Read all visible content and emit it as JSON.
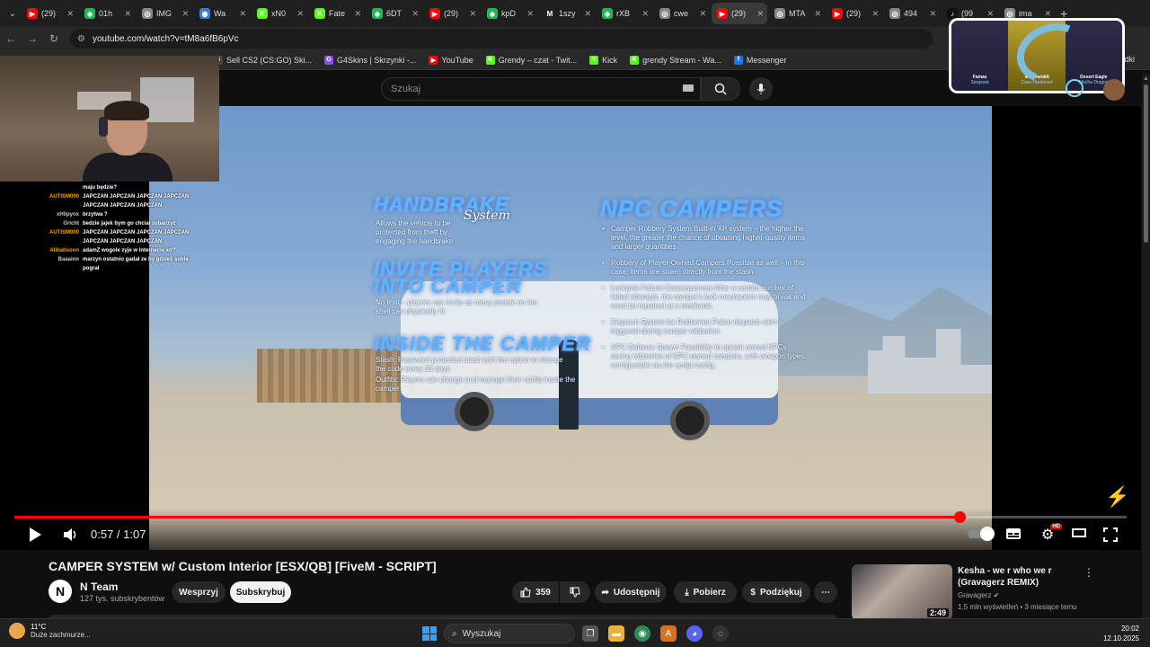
{
  "tabs": [
    {
      "label": "(29)",
      "color": "#ff0000",
      "glyph": "▶",
      "icon": "youtube-icon"
    },
    {
      "label": "01h",
      "color": "#1db954",
      "glyph": "◆",
      "icon": "app-icon"
    },
    {
      "label": "IMG",
      "color": "#888888",
      "glyph": "◎",
      "icon": "globe-icon"
    },
    {
      "label": "Wa",
      "color": "#3a7bd5",
      "glyph": "◉",
      "icon": "app-icon"
    },
    {
      "label": "xN0",
      "color": "#53fc18",
      "glyph": "K",
      "icon": "kick-icon"
    },
    {
      "label": "Fate",
      "color": "#53fc18",
      "glyph": "K",
      "icon": "kick-icon"
    },
    {
      "label": "6DT",
      "color": "#1db954",
      "glyph": "◆",
      "icon": "app-icon"
    },
    {
      "label": "(29)",
      "color": "#ff0000",
      "glyph": "▶",
      "icon": "youtube-icon"
    },
    {
      "label": "kpD",
      "color": "#1db954",
      "glyph": "◆",
      "icon": "app-icon"
    },
    {
      "label": "1szy",
      "color": "#222222",
      "glyph": "M",
      "icon": "app-icon"
    },
    {
      "label": "rXB",
      "color": "#1db954",
      "glyph": "◆",
      "icon": "app-icon"
    },
    {
      "label": "cwe",
      "color": "#888888",
      "glyph": "◎",
      "icon": "globe-icon"
    },
    {
      "label": "(29)",
      "color": "#ff0000",
      "glyph": "▶",
      "icon": "youtube-icon",
      "active": true
    },
    {
      "label": "MTA",
      "color": "#888888",
      "glyph": "◎",
      "icon": "globe-icon"
    },
    {
      "label": "(29)",
      "color": "#ff0000",
      "glyph": "▶",
      "icon": "youtube-icon"
    },
    {
      "label": "494",
      "color": "#888888",
      "glyph": "◎",
      "icon": "globe-icon"
    },
    {
      "label": "(99",
      "color": "#111111",
      "glyph": "♪",
      "icon": "tiktok-icon"
    },
    {
      "label": "ima",
      "color": "#888888",
      "glyph": "◎",
      "icon": "globe-icon"
    }
  ],
  "address": {
    "url": "youtube.com/watch?v=tM8a6fB6pVc"
  },
  "bookmarks": [
    {
      "label": "Sell CS2 (CS:GO) Ski...",
      "color": "#444444",
      "glyph": "S"
    },
    {
      "label": "G4Skins | Skrzynki -...",
      "color": "#8a4cf0",
      "glyph": "G"
    },
    {
      "label": "YouTube",
      "color": "#ff0000",
      "glyph": "▶"
    },
    {
      "label": "Grendy – czat - Twit...",
      "color": "#53fc18",
      "glyph": "K"
    },
    {
      "label": "Kick",
      "color": "#53fc18",
      "glyph": "K"
    },
    {
      "label": "grendy Stream - Wa...",
      "color": "#53fc18",
      "glyph": "K"
    },
    {
      "label": "Messenger",
      "color": "#1877f2",
      "glyph": "f"
    }
  ],
  "bookmarks_right": "kładki",
  "youtube": {
    "search_placeholder": "Szukaj"
  },
  "video": {
    "overlay": {
      "handbrake_title": "HANDBRAKE",
      "handbrake_tag": "System",
      "handbrake_desc": "Allows the vehicle to be protected from theft by engaging the handbrake",
      "invite_title_1": "INVITE PLAYERS",
      "invite_title_2": "INTO CAMPER",
      "invite_desc": "No limit – players can invite as many people as the shell can physically fit",
      "inside_title": "INSIDE THE CAMPER",
      "inside_b1": "Stash: Password-protected stash with the option to change the code every 30 days",
      "inside_b2": "Outfits: Players can change and manage their outfits inside the camper",
      "npc_title": "NPC CAMPERS",
      "npc_bullets": [
        "Camper Robbery System Built-in XP system – the higher the level, the greater the chance of obtaining higher-quality items and larger quantities.",
        "Robbery of Player-Owned Campers Possible as well – in this case, items are stolen directly from the stash.",
        "Lockpick Failure Consequences After a certain number of failed attempts, the camper's lock mechanism may break and must be repaired at a mechanic.",
        "Dispatch System for Robberies Police dispatch alert is triggered during camper robberies.",
        "NPC Defense Spawn Possibility to spawn armed NPCs during robberies of NPC-owned campers, with weapon types configurable via the script config."
      ]
    },
    "progress": 0.85,
    "time_current": "0:57",
    "time_separator": " / ",
    "time_total": "1:07",
    "quality_badge": "HD"
  },
  "chat": [
    {
      "user": "",
      "color": "#ff4040",
      "msg": "maju będzie?"
    },
    {
      "user": "AUTISM000",
      "color": "#ffa000",
      "msg": "JAPCZAN JAPCZAN JAPCZAN JAPCZAN"
    },
    {
      "user": "",
      "color": "#ffa000",
      "msg": "JAPCZAN JAPCZAN JAPCZAN"
    },
    {
      "user": "xHilpynx",
      "color": "#cccccc",
      "msg": "brzytwa ?"
    },
    {
      "user": "Gricht",
      "color": "#cccccc",
      "msg": "bedzie jajek bym go chciał zobaczyć"
    },
    {
      "user": "AUTISM000",
      "color": "#ffa000",
      "msg": "JAPCZAN JAPCZAN JAPCZAN JAPCZAN"
    },
    {
      "user": "",
      "color": "#ffa000",
      "msg": "JAPCZAN JAPCZAN JAPCZAN"
    },
    {
      "user": "Alibabsonn",
      "color": "#ffa000",
      "msg": "adamZ wogole zyje w internecie xd?"
    },
    {
      "user": "Baaainn",
      "color": "#cccccc",
      "msg": "marzyn ostatnio gadał ze by gdzieś sobie"
    },
    {
      "user": "",
      "color": "#cccccc",
      "msg": "pograł"
    }
  ],
  "skins": [
    {
      "name": "Famas",
      "sub": "Sergeant"
    },
    {
      "name": "★ Karambit",
      "sub": "Case Hardened"
    },
    {
      "name": "Desert Eagle",
      "sub": "Mecha Dragon"
    }
  ],
  "info": {
    "title": "CAMPER SYSTEM w/ Custom Interior [ESX/QB] [FiveM - SCRIPT]",
    "channel_logo": "N",
    "channel": "N Team",
    "subscribers": "127 tys. subskrybentów",
    "support": "Wesprzyj",
    "subscribe": "Subskrybuj",
    "likes": "359",
    "share": "Udostępnij",
    "download": "Pobierz",
    "thanks": "Podziękuj",
    "more": "⋯"
  },
  "recommendation": {
    "title": "Kesha - we r who we r (Gravagerz REMIX)",
    "channel": "Gravagerz",
    "meta": "1,5 mln wyświetleń • 3 miesiące temu",
    "duration": "2:49"
  },
  "taskbar": {
    "temp": "11°C",
    "weather": "Duże zachmurze...",
    "search": "Wyszukaj",
    "time": "20:02",
    "date": "12.10.2025"
  },
  "colors": {
    "accent": "#ff0000",
    "background": "#0f0f0f"
  }
}
